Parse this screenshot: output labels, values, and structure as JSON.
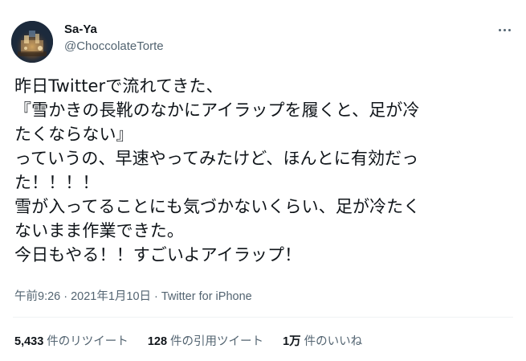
{
  "author": {
    "display_name": "Sa-Ya",
    "handle": "@ChoccolateTorte"
  },
  "tweet": {
    "lines": [
      "昨日Twitterで流れてきた、",
      "『雪かきの長靴のなかにアイラップを履くと、足が冷",
      "たくならない』",
      "っていうの、早速やってみたけど、ほんとに有効だっ",
      "た！！！！",
      "雪が入ってることにも気づかないくらい、足が冷たく",
      "ないまま作業できた。",
      "今日もやる！！すごいよアイラップ！"
    ]
  },
  "meta": {
    "time": "午前9:26",
    "separator": "·",
    "date": "2021年1月10日",
    "source": "Twitter for iPhone"
  },
  "stats": {
    "retweets": {
      "count": "5,433",
      "label": "件のリツイート"
    },
    "quotes": {
      "count": "128",
      "label": "件の引用ツイート"
    },
    "likes": {
      "count": "1万",
      "label": "件のいいね"
    }
  },
  "icons": {
    "more": "more-options-icon",
    "avatar": "avatar-image"
  },
  "colors": {
    "text_primary": "#0f1419",
    "text_secondary": "#536471",
    "divider": "#eff3f4"
  }
}
